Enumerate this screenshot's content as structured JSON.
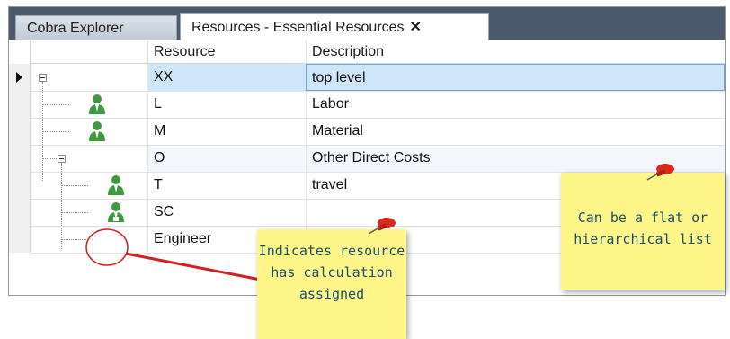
{
  "tabs": [
    {
      "label": "Cobra Explorer"
    },
    {
      "label": "Resources - Essential Resources"
    }
  ],
  "tab_close_icon": "✕",
  "grid": {
    "columns": {
      "resource": "Resource",
      "description": "Description"
    },
    "rows": [
      {
        "resource": "XX",
        "description": "top level"
      },
      {
        "resource": "L",
        "description": "Labor"
      },
      {
        "resource": "M",
        "description": "Material"
      },
      {
        "resource": "O",
        "description": "Other Direct Costs"
      },
      {
        "resource": "T",
        "description": "travel"
      },
      {
        "resource": "SC",
        "description": ""
      },
      {
        "resource": "Engineer",
        "description": ""
      }
    ]
  },
  "notes": {
    "calc": [
      "Indicates resource",
      "has calculation",
      "assigned"
    ],
    "list": [
      "Can be a flat or",
      "hierarchical list"
    ]
  },
  "colors": {
    "person_icon": "#3f9a3f",
    "note_bg": "#fff68a",
    "note_text": "#1b4f6e",
    "pin": "#d62b1f",
    "callout": "#d21f1f"
  }
}
